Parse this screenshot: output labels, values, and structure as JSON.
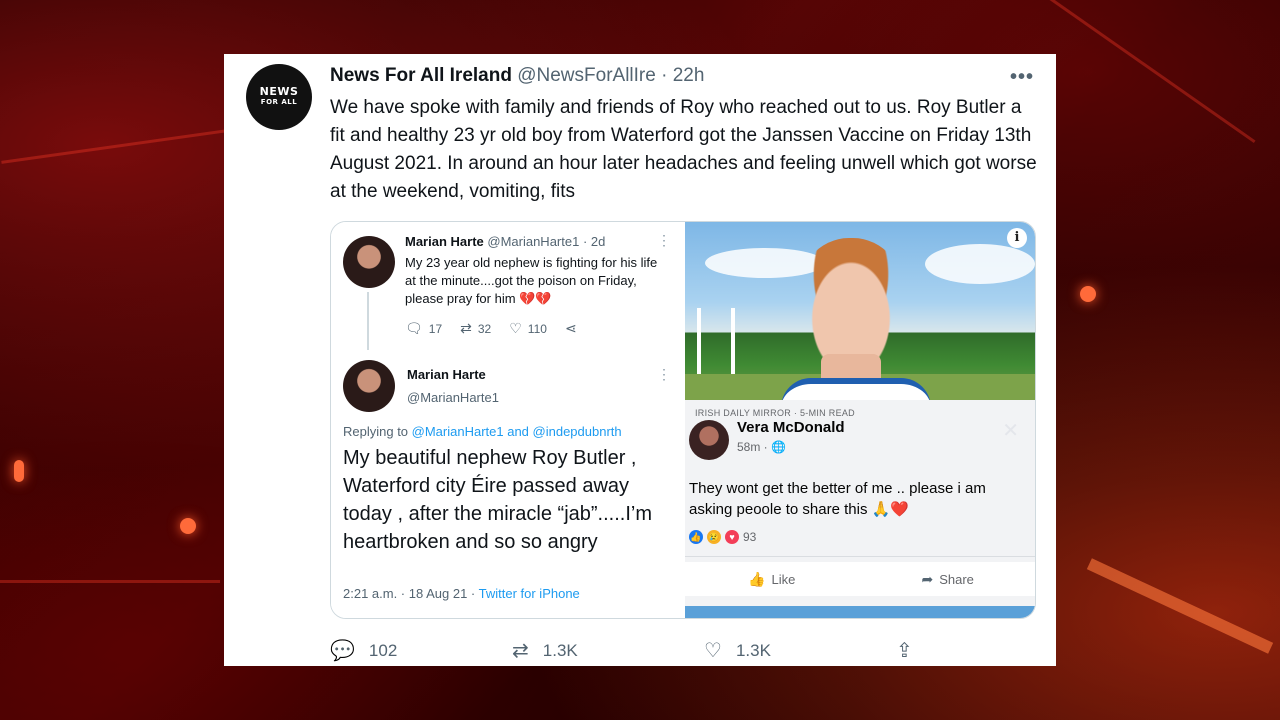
{
  "tweet": {
    "avatar_text_top": "NEWS",
    "avatar_text_mid": "FOR ALL",
    "author_name": "News For All Ireland",
    "author_handle": "@NewsForAllIre",
    "separator": " · ",
    "time": "22h",
    "more_icon": "more-horizontal-icon",
    "text": "We have spoke with family and friends of Roy who reached out to us. Roy Butler a fit and healthy 23 yr old boy from Waterford got the Janssen Vaccine on Friday 13th August 2021. In around an hour later headaches and feeling unwell which got worse at the weekend, vomiting, fits",
    "actions": {
      "reply_count": "102",
      "retweet_count": "1.3K",
      "like_count": "1.3K"
    }
  },
  "embedded_tweet_1": {
    "name": "Marian Harte",
    "handle": "@MarianHarte1",
    "age": "· 2d",
    "text": "My 23 year old nephew is fighting for his life at the minute....got the poison on Friday, please pray for him 💔💔",
    "replies": "17",
    "retweets": "32",
    "likes": "110"
  },
  "embedded_tweet_2": {
    "name": "Marian Harte",
    "handle": "@MarianHarte1",
    "replying_prefix": "Replying to ",
    "replying_to": "@MarianHarte1 and @indepdubnrth",
    "text": "My beautiful nephew Roy Butler , Waterford city Éire passed away today , after the miracle “jab”.....I’m heartbroken and so so angry",
    "timestamp": "2:21 a.m. · 18 Aug 21 · ",
    "source": "Twitter for iPhone"
  },
  "facebook_post": {
    "source_label": "IRISH DAILY MIRROR · 5-MIN READ",
    "info_label": "i",
    "name": "Vera McDonald",
    "time": "58m · 🌐",
    "text": "They wont get the better of me .. please i am asking peoole to share this 🙏❤️",
    "reaction_count": "93",
    "like_label": "Like",
    "share_label": "Share",
    "close_label": "✕"
  },
  "colors": {
    "twitter_blue": "#1d9bf0",
    "fb_blue": "#1877f2",
    "background_red": "#3a0303"
  }
}
